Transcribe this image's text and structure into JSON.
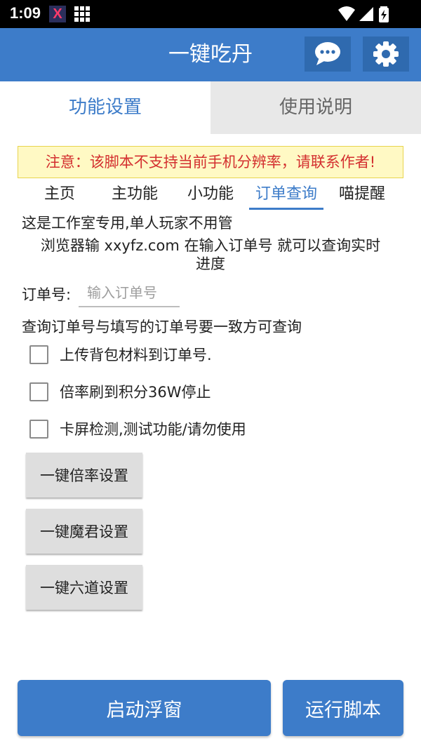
{
  "status_bar": {
    "time": "1:09",
    "app_icon_letter": "X",
    "colors": {
      "background": "#000000"
    }
  },
  "app_bar": {
    "title": "一键吃丹",
    "color": "#3d7cc9"
  },
  "tabs": [
    {
      "label": "功能设置",
      "active": true
    },
    {
      "label": "使用说明",
      "active": false
    }
  ],
  "notice": "注意：该脚本不支持当前手机分辨率，请联系作者!",
  "subtabs": [
    {
      "label": "主页",
      "active": false
    },
    {
      "label": "主功能",
      "active": false
    },
    {
      "label": "小功能",
      "active": false
    },
    {
      "label": "订单查询",
      "active": true
    },
    {
      "label": "喵提醒",
      "active": false
    }
  ],
  "content": {
    "line1": "这是工作室专用,单人玩家不用管",
    "line2a": "浏览器输 xxyfz.com  在输入订单号 就可以查询实时",
    "line2b": "进度",
    "order_label": "订单号:",
    "order_placeholder": "输入订单号",
    "order_value": "",
    "hint": "查询订单号与填写的订单号要一致方可查询"
  },
  "checkboxes": [
    {
      "label": "上传背包材料到订单号.",
      "checked": false
    },
    {
      "label": "倍率刷到积分36W停止",
      "checked": false
    },
    {
      "label": "卡屏检测,测试功能/请勿使用",
      "checked": false
    }
  ],
  "buttons": [
    {
      "label": "一键倍率设置"
    },
    {
      "label": "一键魔君设置"
    },
    {
      "label": "一键六道设置"
    }
  ],
  "bottom_buttons": {
    "float_window": "启动浮窗",
    "run_script": "运行脚本"
  },
  "icons": {
    "chat": "chat-bubble-icon",
    "settings": "gear-icon",
    "wifi": "wifi-icon",
    "signal": "signal-icon",
    "battery": "battery-icon"
  }
}
